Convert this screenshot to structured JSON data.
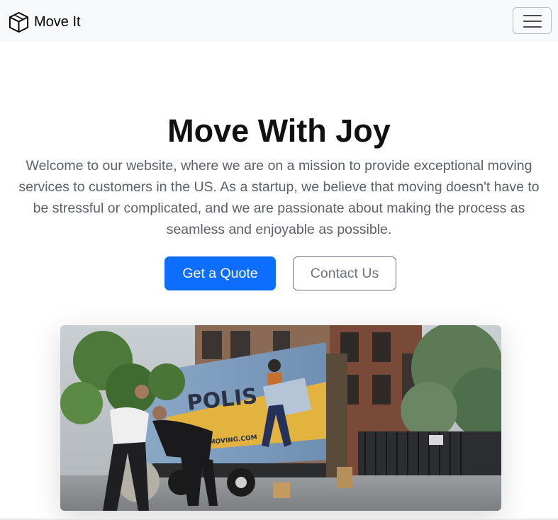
{
  "navbar": {
    "brand_icon": "box-icon",
    "brand_text": "Move It",
    "toggler_icon": "hamburger-menu-icon"
  },
  "hero": {
    "title": "Move With Joy",
    "lead": "Welcome to our website, where we are on a mission to provide exceptional moving services to customers in the US. As a startup, we believe that moving doesn't have to be stressful or complicated, and we are passionate about making the process as seamless and enjoyable as possible.",
    "primary_button": "Get a Quote",
    "secondary_button": "Contact Us"
  },
  "image": {
    "truck_text_main": "POLIS",
    "truck_text_web": "MOVING.COM"
  },
  "colors": {
    "primary": "#0d6efd",
    "secondary": "#6c757d",
    "navbar_bg": "#f8f9fa"
  }
}
